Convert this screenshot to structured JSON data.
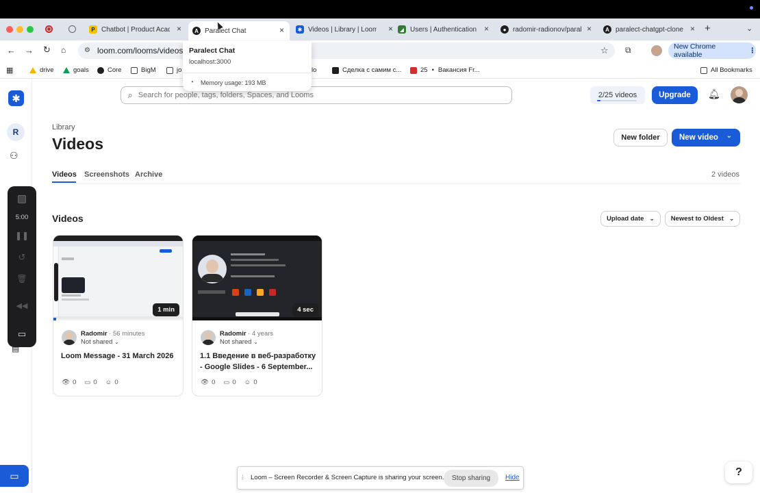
{
  "browser": {
    "tabs": [
      {
        "label": "Chatbot | Product Acad",
        "favicon_letter": "P",
        "favicon_color": "#f2c200"
      },
      {
        "label": "Paralect Chat",
        "favicon_letter": "A",
        "favicon_color": "#1f1f1f"
      },
      {
        "label": "Videos | Library | Loom",
        "favicon_letter": "✱",
        "favicon_color": "#1a5cd8"
      },
      {
        "label": "Users | Authentication",
        "favicon_letter": "◢",
        "favicon_color": "#2e7d32"
      },
      {
        "label": "radomir-radionov/paral",
        "favicon_letter": "●",
        "favicon_color": "#1f1f1f"
      },
      {
        "label": "paralect-chatgpt-clone",
        "favicon_letter": "A",
        "favicon_color": "#1f1f1f"
      }
    ],
    "url": "loom.com/looms/videos",
    "new_chrome": "New Chrome available",
    "bookmarks": [
      "drive",
      "goals",
      "Core",
      "BigM",
      "jo",
      "Сделка с самим с...",
      "25",
      "Вакансия Fr..."
    ],
    "all_bookmarks": "All Bookmarks",
    "bookmark_partial": "lo"
  },
  "tooltip": {
    "title": "Paralect Chat",
    "url": "localhost:3000",
    "memory": "Memory usage: 193 MB"
  },
  "header": {
    "search_placeholder": "Search for people, tags, folders, Spaces, and Looms",
    "quota": "2/25 videos",
    "quota_progress": 0.08,
    "upgrade": "Upgrade"
  },
  "sidebar": {
    "workspace_initial": "R"
  },
  "recorder": {
    "timer": "5:00"
  },
  "library": {
    "breadcrumb": "Library",
    "title": "Videos",
    "new_folder": "New folder",
    "new_video": "New video",
    "tabs": [
      "Videos",
      "Screenshots",
      "Archive"
    ],
    "count": "2 videos",
    "section_title": "Videos",
    "sort_field": "Upload date",
    "sort_order": "Newest to Oldest"
  },
  "videos": [
    {
      "duration": "1 min",
      "author": "Radomir",
      "age": " · 56 minutes",
      "shared": "Not shared",
      "title": "Loom Message - 31 March 2026",
      "views": "0",
      "comments": "0",
      "reactions": "0"
    },
    {
      "duration": "4 sec",
      "author": "Radomir",
      "age": " · 4 years",
      "shared": "Not shared",
      "title": "1.1 Введение в веб-разработку - Google Slides - 6 September...",
      "views": "0",
      "comments": "0",
      "reactions": "0"
    }
  ],
  "sharebar": {
    "message": "Loom – Screen Recorder & Screen Capture is sharing your screen.",
    "stop": "Stop sharing",
    "hide": "Hide"
  },
  "help": "?"
}
